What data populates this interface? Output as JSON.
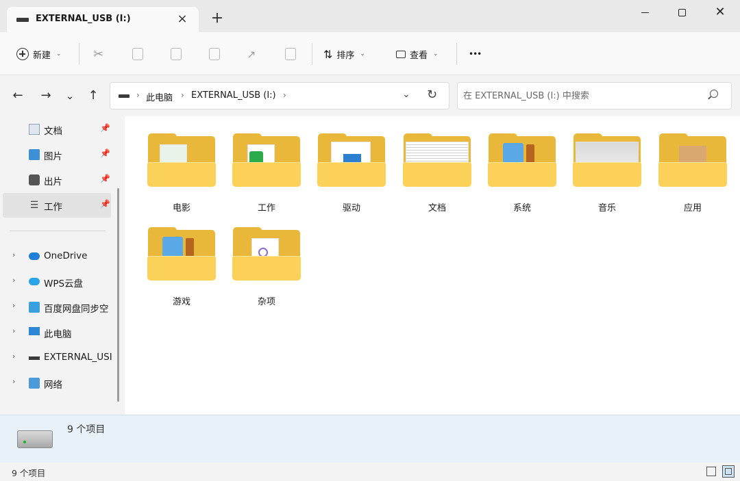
{
  "window": {
    "tab_title": "EXTERNAL_USB (I:)",
    "tab_close": "×",
    "new_tab": "+",
    "close_glyph": "✕"
  },
  "toolbar": {
    "new_label": "新建",
    "sort_label": "排序",
    "view_label": "查看",
    "more_label": "•••"
  },
  "nav": {
    "back": "←",
    "forward": "→",
    "recent": "⌄",
    "up": "↑"
  },
  "address": {
    "crumbs": [
      "此电脑",
      "EXTERNAL_USB (I:)"
    ],
    "separator": "›",
    "dropdown": "⌄",
    "refresh": "↻"
  },
  "search": {
    "placeholder": "在 EXTERNAL_USB (I:) 中搜索"
  },
  "sidebar": {
    "pinned": [
      {
        "label": "文档",
        "icon": "document-icon"
      },
      {
        "label": "图片",
        "icon": "picture-icon"
      },
      {
        "label": "出片",
        "icon": "photo-folder-icon"
      },
      {
        "label": "工作",
        "icon": "list-icon"
      }
    ],
    "pin_glyph": "📌",
    "locations": [
      {
        "label": "OneDrive",
        "icon": "cloud-icon"
      },
      {
        "label": "WPS云盘",
        "icon": "wps-cloud-icon"
      },
      {
        "label": "百度网盘同步空",
        "icon": "baidu-netdisk-icon"
      },
      {
        "label": "此电脑",
        "icon": "computer-icon"
      },
      {
        "label": "EXTERNAL_USI",
        "icon": "usb-drive-icon"
      },
      {
        "label": "网络",
        "icon": "network-icon"
      }
    ],
    "expand_glyph": "›"
  },
  "folders": [
    {
      "name": "电影"
    },
    {
      "name": "工作"
    },
    {
      "name": "驱动"
    },
    {
      "name": "文档"
    },
    {
      "name": "系统"
    },
    {
      "name": "音乐"
    },
    {
      "name": "应用"
    },
    {
      "name": "游戏"
    },
    {
      "name": "杂项"
    }
  ],
  "details": {
    "item_count": "9 个项目"
  },
  "status": {
    "item_count": "9 个项目"
  },
  "colors": {
    "folder_back": "#e9b73a",
    "folder_front": "#fcd15a",
    "details_bg": "#e8f0f8"
  }
}
